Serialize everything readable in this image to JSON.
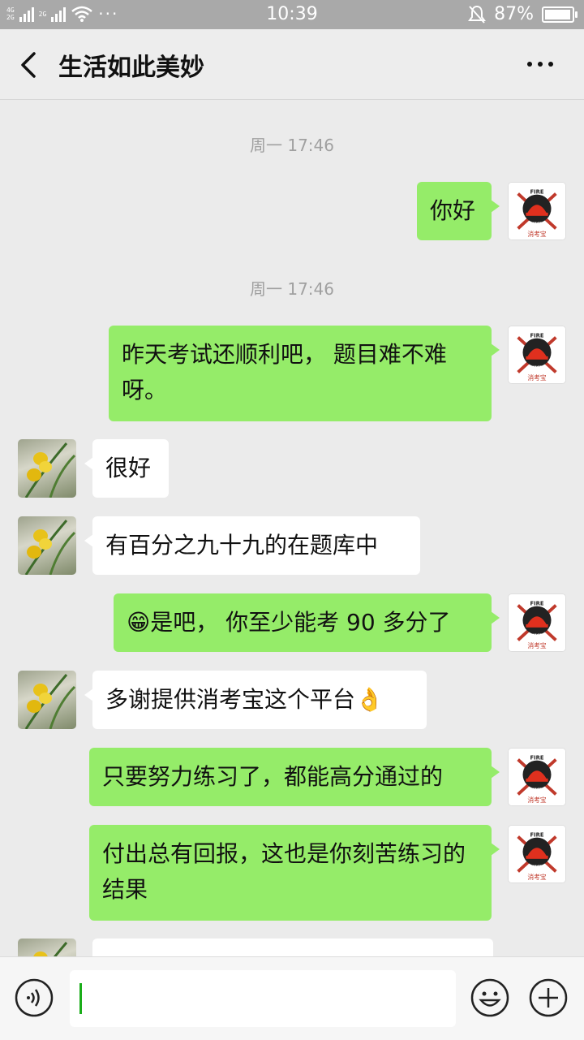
{
  "status_bar": {
    "net1": "4G",
    "net2": "2G",
    "net3": "2G",
    "time": "10:39",
    "battery": "87%",
    "battery_level": 0.87
  },
  "header": {
    "title": "生活如此美妙",
    "back_icon": "chevron-left-icon",
    "more_icon": "more-dots-icon"
  },
  "messages": [
    {
      "type": "time",
      "text": "周一 17:46"
    },
    {
      "type": "me",
      "text": "你好"
    },
    {
      "type": "time",
      "text": "周一 17:46"
    },
    {
      "type": "me",
      "text": "昨天考试还顺利吧， 题目难不难呀。"
    },
    {
      "type": "them",
      "text": "很好"
    },
    {
      "type": "them",
      "text": "有百分之九十九的在题库中"
    },
    {
      "type": "me",
      "text": "是吧， 你至少能考 90 多分了",
      "emoji": "😁"
    },
    {
      "type": "them",
      "text": "多谢提供消考宝这个平台",
      "emoji_after": "👌"
    },
    {
      "type": "me",
      "text": "只要努力练习了，都能高分通过的"
    },
    {
      "type": "me",
      "text": "付出总有回报，这也是你刻苦练习的结果"
    }
  ],
  "avatar_me": {
    "top_text": "FIRE",
    "bottom_text": "XKB",
    "caption": "消考宝"
  },
  "input_bar": {
    "voice_icon": "voice-icon",
    "emoji_icon": "emoji-icon",
    "plus_icon": "plus-icon",
    "value": ""
  },
  "colors": {
    "my_bubble": "#95ec69",
    "their_bubble": "#ffffff",
    "background": "#ebebeb",
    "status_bar": "#a9a9a9"
  }
}
